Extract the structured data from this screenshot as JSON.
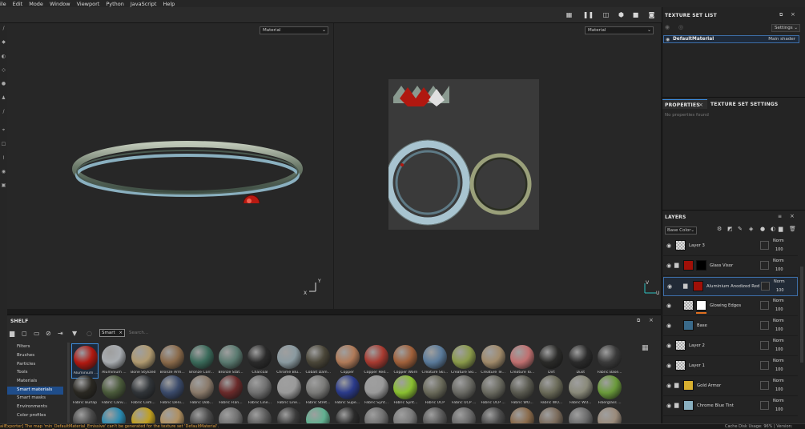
{
  "menu": [
    "ile",
    "Edit",
    "Mode",
    "Window",
    "Viewport",
    "Python",
    "JavaScript",
    "Help"
  ],
  "viewport3d": {
    "material_select": "Material",
    "axis_x": "X",
    "axis_y": "Y"
  },
  "viewport2d": {
    "material_select": "Material",
    "axis_v": "V",
    "axis_u": "U"
  },
  "texture_set_list": {
    "title": "TEXTURE SET LIST",
    "settings_label": "Settings",
    "set_name": "DefaultMaterial",
    "set_shader": "Main shader"
  },
  "properties": {
    "tab_properties": "PROPERTIES",
    "tab_texture_settings": "TEXTURE SET SETTINGS",
    "empty_text": "No properties found"
  },
  "layers": {
    "title": "LAYERS",
    "channel_select": "Base Color",
    "items": [
      {
        "name": "Layer 3",
        "blend": "Norm",
        "opacity": "100"
      },
      {
        "name": "Glass Visor",
        "blend": "Norm",
        "opacity": "100"
      },
      {
        "name": "Aluminium Anodized Red",
        "blend": "Norm",
        "opacity": "100"
      },
      {
        "name": "Glowing Edges",
        "blend": "Norm",
        "opacity": "100"
      },
      {
        "name": "Base",
        "blend": "Norm",
        "opacity": "100"
      },
      {
        "name": "Layer 2",
        "blend": "Norm",
        "opacity": "100"
      },
      {
        "name": "Layer 1",
        "blend": "Norm",
        "opacity": "100"
      },
      {
        "name": "Gold Armor",
        "blend": "Norm",
        "opacity": "100"
      },
      {
        "name": "Chrome Blue Tint",
        "blend": "Norm",
        "opacity": "100"
      }
    ]
  },
  "shelf": {
    "title": "SHELF",
    "search_tag": "Smart",
    "search_placeholder": "Search...",
    "categories": [
      "Filters",
      "Brushes",
      "Particles",
      "Tools",
      "Materials",
      "Smart materials",
      "Smart masks",
      "Environments",
      "Color profiles"
    ],
    "row1": [
      "Aluminium ...",
      "Aluminium ...",
      "Bone Stylized",
      "Bronze Arm...",
      "Bronze Corr...",
      "Bronze Stat...",
      "Charcoal",
      "Chrome Blu...",
      "Cobalt Dam...",
      "Copper",
      "Copper Red...",
      "Copper Worn",
      "Creature Ski...",
      "Creature Ski...",
      "Creature Te...",
      "Creature To...",
      "Dirt",
      "Dust",
      "Fabric Base..."
    ],
    "row2": [
      "Fabric Burlap",
      "Fabric Canv...",
      "Fabric Com...",
      "Fabric Deni...",
      "Fabric Dob...",
      "Fabric Flan...",
      "Fabric Line...",
      "Fabric Line...",
      "Fabric Stret...",
      "Fabric Supe...",
      "Fabric Synt...",
      "Fabric Synt...",
      "Fabric UCP",
      "Fabric UCP ...",
      "Fabric UCP ...",
      "Fabric WO...",
      "Fabric WO...",
      "Fabric WO...",
      "Fiberglass ..."
    ],
    "row1_colors": [
      "#b01810",
      "#a8acb0",
      "#b09a70",
      "#8a6a4a",
      "#3a6a5a",
      "#5a7a70",
      "#2a2a2a",
      "#8a9aa0",
      "#4a4638",
      "#b07a58",
      "#a83a30",
      "#a0603a",
      "#5a7a9a",
      "#8a9a4a",
      "#a08a6a",
      "#c07070",
      "#2a2a28",
      "#2a2a2a",
      "#3a3a3a"
    ],
    "row2_colors": [
      "#2a2822",
      "#4a5a3a",
      "#303438",
      "#3a4a6a",
      "#8a7a6a",
      "#6a2a2a",
      "#707070",
      "#9a9a9a",
      "#7a7a78",
      "#2a3a8a",
      "#9a9a9a",
      "#8ac030",
      "#6a6a5a",
      "#6a6a64",
      "#6a6a60",
      "#5a5a50",
      "#6a6a58",
      "#8a8a7a",
      "#6a9a3a"
    ],
    "row3_colors": [
      "#4a4a4a",
      "#2a8ab0",
      "#c0a020",
      "#b09060",
      "#4a4a4a",
      "#707070",
      "#5a5a5a",
      "#3a3a3a",
      "#60b090",
      "#2a2a2a",
      "#707070",
      "#7a7a7a",
      "#5a5a5a",
      "#6a6a6a",
      "#4a4a4a",
      "#8a6a4a",
      "#7a6a5a",
      "#6a6a6a",
      "#9a8a7a"
    ]
  },
  "status": {
    "message": "ailExporter] The map 'min_DefaultMaterial_Emissive' can't be generated for the texture set 'DefaultMaterial'.",
    "disk_usage": "Cache Disk Usage: 96% | Version: "
  },
  "colors": {
    "accent": "#3d8ee0",
    "selection": "#1f4d8a",
    "warning": "#e0a040"
  }
}
